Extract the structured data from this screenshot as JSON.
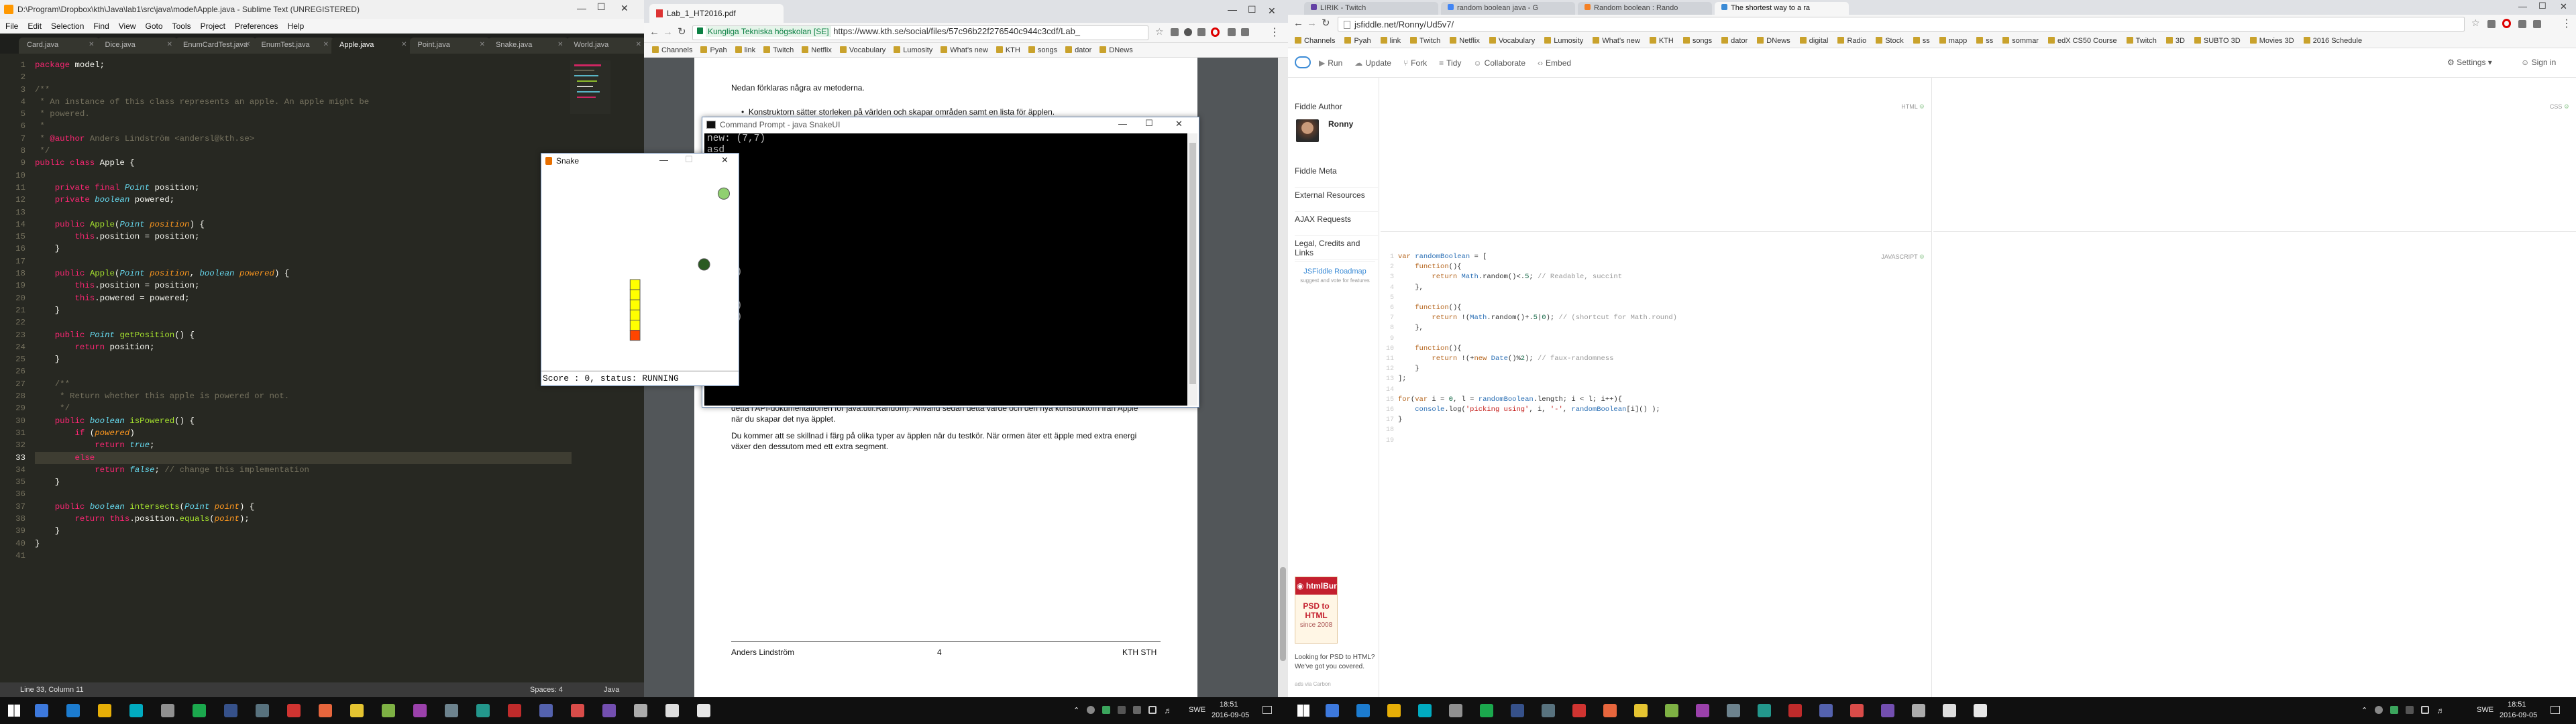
{
  "sublime": {
    "title": "D:\\Program\\Dropbox\\kth\\Java\\lab1\\src\\java\\model\\Apple.java - Sublime Text (UNREGISTERED)",
    "menu": [
      "File",
      "Edit",
      "Selection",
      "Find",
      "View",
      "Goto",
      "Tools",
      "Project",
      "Preferences",
      "Help"
    ],
    "tabs": [
      "Card.java",
      "Dice.java",
      "EnumCardTest.java",
      "EnumTest.java",
      "Apple.java",
      "Point.java",
      "Snake.java",
      "World.java"
    ],
    "active_tab": 4,
    "status_left": "Line 33, Column 11",
    "status_spaces": "Spaces: 4",
    "status_syntax": "Java",
    "code": [
      "package model;",
      "",
      "/**",
      " * An instance of this class represents an apple. An apple might be",
      " * powered.",
      " *",
      " * @author Anders Lindström <andersl@kth.se>",
      " */",
      "public class Apple {",
      "",
      "    private final Point position;",
      "    private boolean powered;",
      "",
      "    public Apple(Point position) {",
      "        this.position = position;",
      "    }",
      "",
      "    public Apple(Point position, boolean powered) {",
      "        this.position = position;",
      "        this.powered = powered;",
      "    }",
      "",
      "    public Point getPosition() {",
      "        return position;",
      "    }",
      "",
      "    /**",
      "     * Return whether this apple is powered or not.",
      "     */",
      "    public boolean isPowered() {",
      "        if (powered)",
      "            return true;",
      "        else",
      "            return false; // change this implementation",
      "    }",
      "",
      "    public boolean intersects(Point point) {",
      "        return this.position.equals(point);",
      "    }",
      "}",
      ""
    ]
  },
  "snake": {
    "title": "Snake",
    "status": "Score : 0, status: RUNNING"
  },
  "cmd": {
    "title": "Command Prompt - java SnakeUI",
    "lines": [
      "new: (7,7)",
      "asd",
      "",
      "(7,7)",
      "(7,8)",
      "asd",
      "",
      "(7,8)",
      "(7,9)",
      "asd",
      "",
      "(7,9)",
      "(7,10)",
      "asd",
      "",
      "(7,10)",
      "(7,11)",
      "asd"
    ]
  },
  "browser1": {
    "tab_title": "Lab_1_HT2016.pdf",
    "secure_label": "Kungliga Tekniska högskolan [SE]",
    "url": "https://www.kth.se/social/files/57c96b22f276540c944c3cdf/Lab_",
    "bookmarks": [
      "Channels",
      "Pyah",
      "link",
      "Twitch",
      "Netflix",
      "Vocabulary",
      "Lumosity",
      "What's new",
      "KTH",
      "songs",
      "dator",
      "DNews"
    ],
    "pdf_top": "Nedan förklaras några av metoderna.",
    "pdf_bullet": "Konstruktorn sätter storleken på världen och skapar områden samt en lista för äpplen.",
    "pdf_p1": "detta i API-dokumentationen för java.util.Random). Använd sedan detta värde och den nya konstruktorn från Apple när du skapar det nya äpplet.",
    "pdf_p2": "Du kommer att se skillnad i färg på olika typer av äpplen när du testkör. När ormen äter ett äpple med extra energi växer den dessutom med ett extra segment.",
    "footer_left": "Anders Lindström",
    "footer_mid": "4",
    "footer_right": "KTH STH"
  },
  "browser2": {
    "tabs": [
      "LIRIK - Twitch",
      "random boolean java - G",
      "Random boolean : Rando",
      "The shortest way to a ra"
    ],
    "active_tab": 3,
    "url": "jsfiddle.net/Ronny/Ud5v7/",
    "bookmarks": [
      "Channels",
      "Pyah",
      "link",
      "Twitch",
      "Netflix",
      "Vocabulary",
      "Lumosity",
      "What's new",
      "KTH",
      "songs",
      "dator",
      "DNews",
      "digital",
      "Radio",
      "Stock",
      "ss",
      "mapp",
      "ss",
      "sommar",
      "edX CS50 Course",
      "Twitch",
      "3D",
      "SUBTO 3D",
      "Movies 3D",
      "2016 Schedule"
    ],
    "toolbar": [
      "Run",
      "Update",
      "Fork",
      "Tidy",
      "Collaborate",
      "Embed"
    ],
    "settings": "Settings",
    "signin": "Sign in",
    "author_heading": "Fiddle Author",
    "author_name": "Ronny",
    "side_links": [
      "Fiddle Meta",
      "External Resources",
      "AJAX Requests",
      "Legal, Credits and Links"
    ],
    "roadmap_title": "JSFiddle Roadmap",
    "roadmap_sub": "suggest and vote for features",
    "ad_brand": "htmlBurger",
    "ad_headline": "PSD to HTML",
    "ad_since": "since 2008",
    "ad_text": "Looking for PSD to HTML? We've got you covered.",
    "ad_via": "ads via Carbon",
    "html_label": "HTML",
    "css_label": "CSS",
    "js_label": "JAVASCRIPT",
    "js_code": [
      "var randomBoolean = [",
      "    function(){",
      "        return Math.random()<.5; // Readable, succint",
      "    },",
      "",
      "    function(){",
      "        return !(Math.random()+.5|0); // (shortcut for Math.round)",
      "    },",
      "",
      "    function(){",
      "        return !(+new Date()%2); // faux-randomness",
      "    }",
      "];",
      "",
      "for(var i = 0, l = randomBoolean.length; i < l; i++){",
      "    console.log('picking using', i, '-', randomBoolean[i]() );",
      "}",
      "",
      ""
    ]
  },
  "taskbar_left": {
    "lang": "SWE",
    "time": "18:51",
    "date": "2016-09-05"
  },
  "taskbar_right": {
    "lang": "SWE",
    "time": "18:51",
    "date": "2016-09-05"
  },
  "snake_state": {
    "grid_cols": 20,
    "grid_rows": 20,
    "apple1": {
      "col": 18,
      "row": 2,
      "color": "#90d070"
    },
    "apple2": {
      "col": 16,
      "row": 9,
      "color": "#2a5a22"
    },
    "body": [
      {
        "col": 9,
        "row": 11
      },
      {
        "col": 9,
        "row": 12
      },
      {
        "col": 9,
        "row": 13
      },
      {
        "col": 9,
        "row": 14
      },
      {
        "col": 9,
        "row": 15
      }
    ],
    "head": {
      "col": 9,
      "row": 16
    }
  }
}
